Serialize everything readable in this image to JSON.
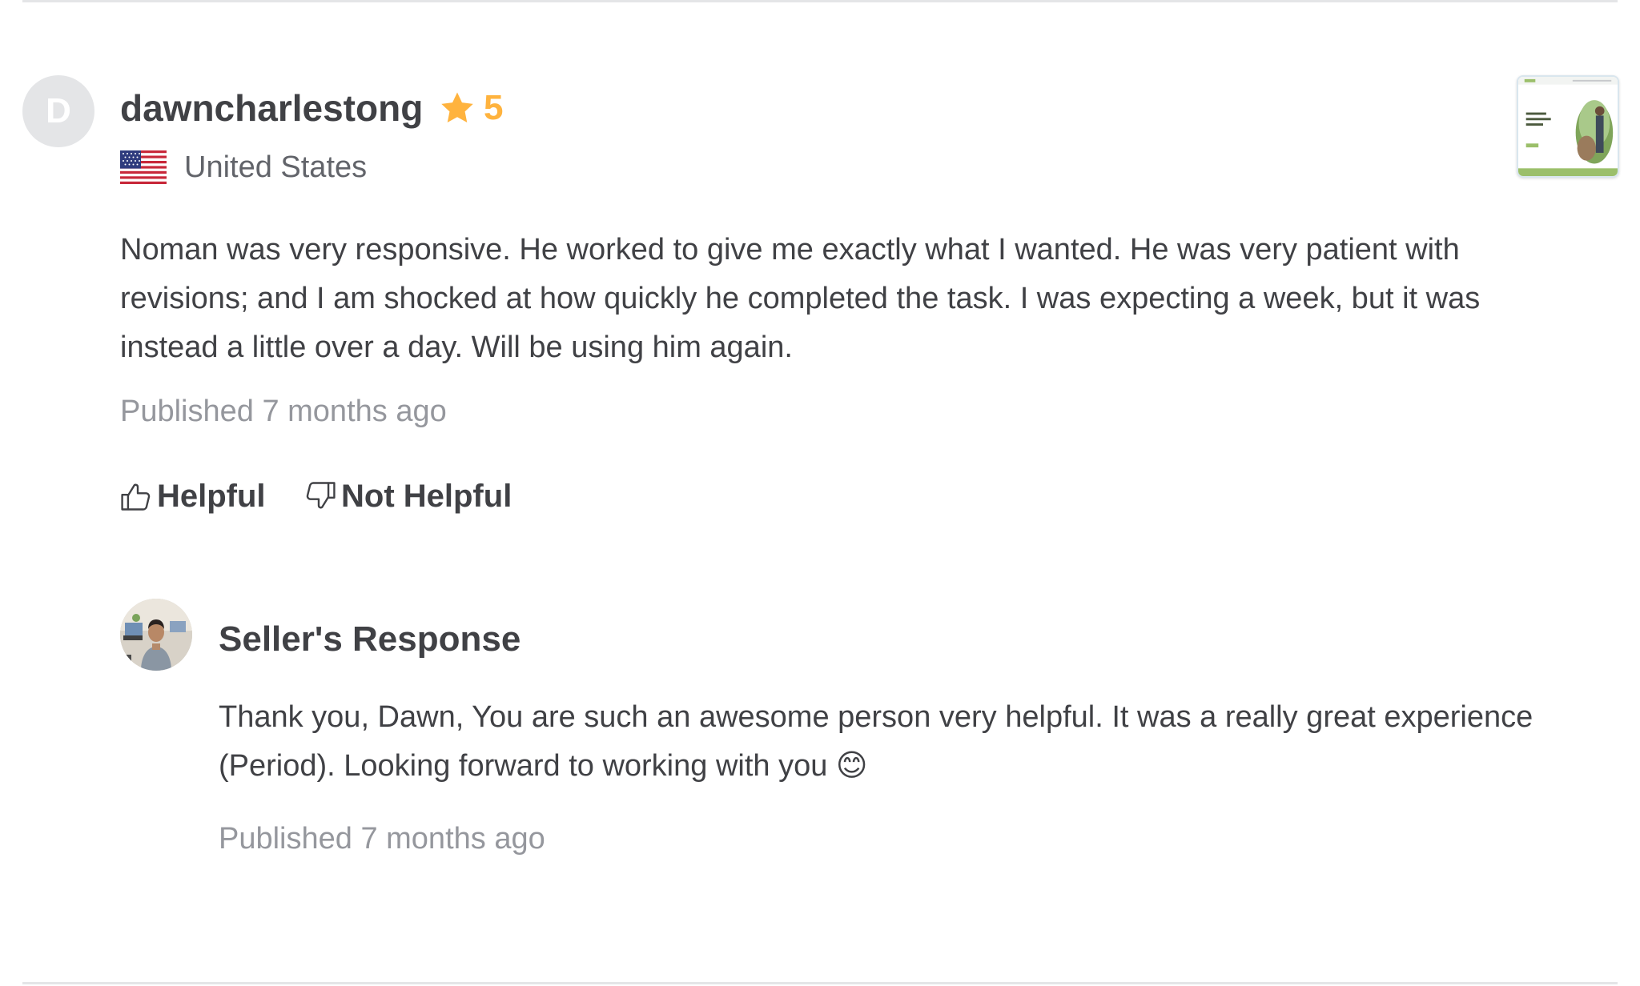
{
  "review": {
    "avatar_letter": "D",
    "username": "dawncharlestong",
    "rating": "5",
    "country": "United States",
    "text": "Noman was very responsive. He worked to give me exactly what I wanted. He was very patient with revisions; and I am shocked at how quickly he completed the task. I was expecting a week, but it was instead a little over a day. Will be using him again.",
    "published": "Published 7 months ago",
    "helpful_label": "Helpful",
    "not_helpful_label": "Not Helpful"
  },
  "seller_response": {
    "title": "Seller's Response",
    "text": "Thank you, Dawn, You are such an awesome person very helpful. It was a really great experience (Period). Looking forward to working with you 😊",
    "published": "Published 7 months ago"
  },
  "colors": {
    "star": "#ffb33e",
    "text_primary": "#404145",
    "text_muted": "#95979d",
    "divider": "#e4e5e7"
  },
  "icons": {
    "rating": "star-icon",
    "country": "us-flag-icon",
    "helpful": "thumbs-up-icon",
    "not_helpful": "thumbs-down-icon"
  }
}
